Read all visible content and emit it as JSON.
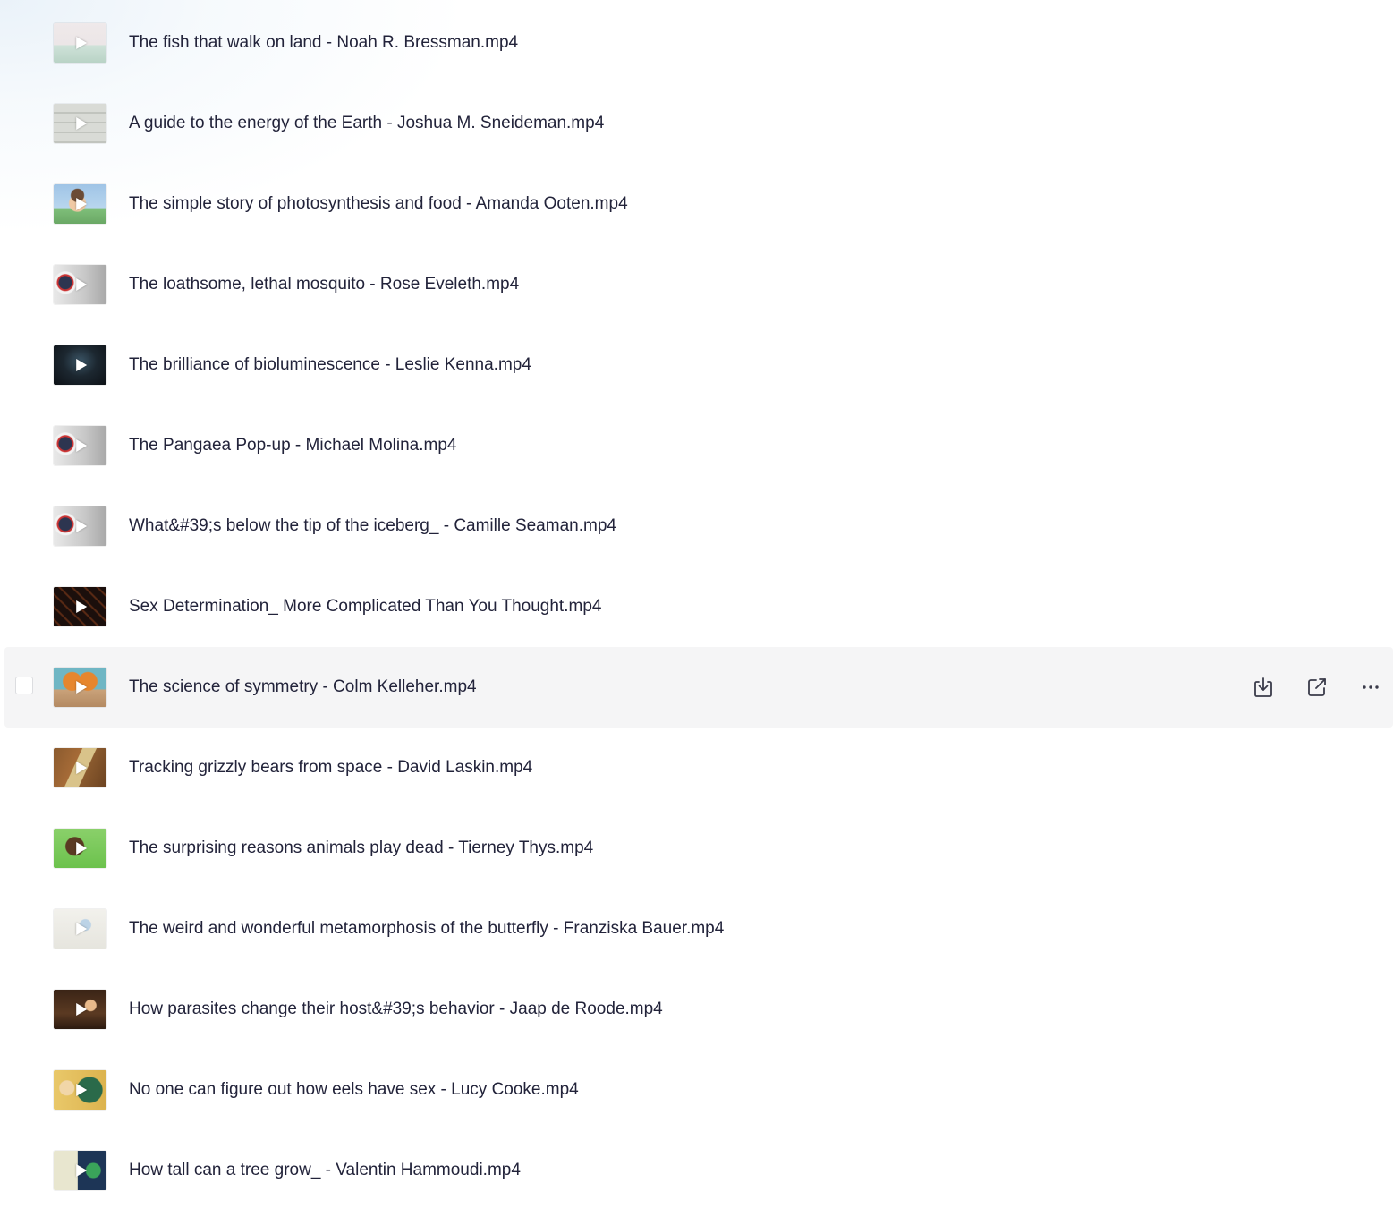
{
  "files": [
    {
      "name": "The fish that walk on land - Noah R. Bressman.mp4",
      "thumb": "pale"
    },
    {
      "name": "A guide to the energy of the Earth - Joshua M. Sneideman.mp4",
      "thumb": "grey-lines"
    },
    {
      "name": "The simple story of photosynthesis and food - Amanda Ooten.mp4",
      "thumb": "sky-figure"
    },
    {
      "name": "The loathsome, lethal mosquito - Rose Eveleth.mp4",
      "thumb": "ted-ed-grey"
    },
    {
      "name": "The brilliance of bioluminescence - Leslie Kenna.mp4",
      "thumb": "dark"
    },
    {
      "name": "The Pangaea Pop-up - Michael Molina.mp4",
      "thumb": "ted-ed-grey"
    },
    {
      "name": "What&#39;s below the tip of the iceberg_ - Camille Seaman.mp4",
      "thumb": "ted-ed-grey"
    },
    {
      "name": "Sex Determination_ More Complicated Than You Thought.mp4",
      "thumb": "dark-pattern"
    },
    {
      "name": "The science of symmetry - Colm Kelleher.mp4",
      "thumb": "butterfly",
      "selected": true
    },
    {
      "name": "Tracking grizzly bears from space - David Laskin.mp4",
      "thumb": "brown-book"
    },
    {
      "name": "The surprising reasons animals play dead - Tierney Thys.mp4",
      "thumb": "green-bird"
    },
    {
      "name": "The weird and wonderful metamorphosis of the butterfly - Franziska Bauer.mp4",
      "thumb": "sketch"
    },
    {
      "name": "How parasites change their host&#39;s behavior - Jaap de Roode.mp4",
      "thumb": "dark-brown"
    },
    {
      "name": "No one can figure out how eels have sex - Lucy Cooke.mp4",
      "thumb": "yellow-eel"
    },
    {
      "name": "How tall can a tree grow_ - Valentin Hammoudi.mp4",
      "thumb": "navy-tree"
    }
  ],
  "actions": {
    "download_icon": "download-icon",
    "open_icon": "external-link-icon",
    "more_icon": "more-horizontal-icon"
  },
  "colors": {
    "text": "#22233a",
    "selected_row_bg": "#f5f5f6",
    "icon": "#3a3b4a"
  }
}
